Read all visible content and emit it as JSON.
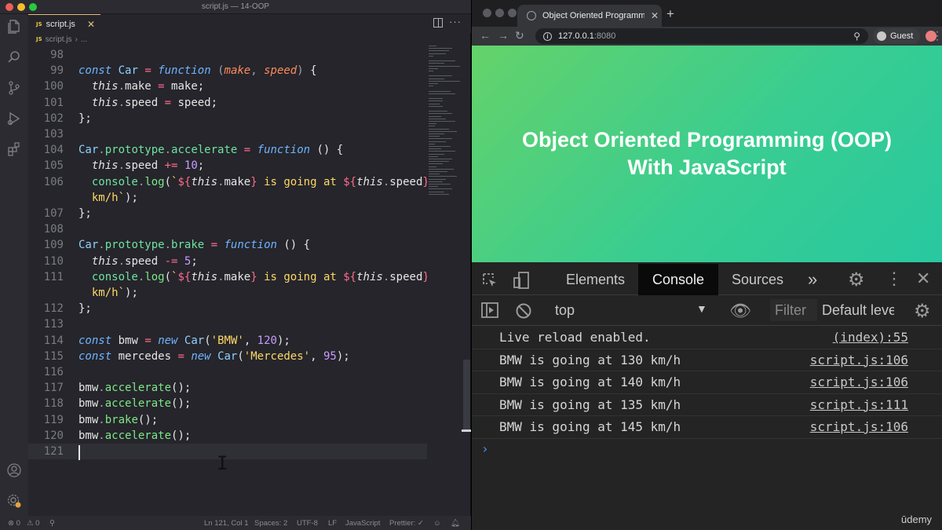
{
  "vscode": {
    "window_title": "script.js — 14-OOP",
    "tab": {
      "badge": "JS",
      "label": "script.js",
      "close": "✕"
    },
    "breadcrumb": {
      "badge": "JS",
      "file": "script.js",
      "sep": "›",
      "more": "..."
    },
    "lines": [
      {
        "n": "98",
        "tokens": []
      },
      {
        "n": "99",
        "tokens": [
          [
            "k",
            "const"
          ],
          [
            "t",
            " "
          ],
          [
            "cls",
            "Car"
          ],
          [
            "t",
            " "
          ],
          [
            "op",
            "="
          ],
          [
            "t",
            " "
          ],
          [
            "k",
            "function"
          ],
          [
            "t",
            " "
          ],
          [
            "pn",
            "("
          ],
          [
            "param",
            "make"
          ],
          [
            "pn",
            ", "
          ],
          [
            "param",
            "speed"
          ],
          [
            "pn",
            ")"
          ],
          [
            "t",
            " {"
          ]
        ]
      },
      {
        "n": "100",
        "tokens": [
          [
            "t",
            "  "
          ],
          [
            "th",
            "this"
          ],
          [
            "pn",
            "."
          ],
          [
            "t",
            "make "
          ],
          [
            "op",
            "="
          ],
          [
            "t",
            " make;"
          ]
        ]
      },
      {
        "n": "101",
        "tokens": [
          [
            "t",
            "  "
          ],
          [
            "th",
            "this"
          ],
          [
            "pn",
            "."
          ],
          [
            "t",
            "speed "
          ],
          [
            "op",
            "="
          ],
          [
            "t",
            " speed;"
          ]
        ]
      },
      {
        "n": "102",
        "tokens": [
          [
            "t",
            "};"
          ]
        ]
      },
      {
        "n": "103",
        "tokens": []
      },
      {
        "n": "104",
        "tokens": [
          [
            "cls",
            "Car"
          ],
          [
            "pn",
            "."
          ],
          [
            "prop",
            "prototype"
          ],
          [
            "pn",
            "."
          ],
          [
            "prop",
            "accelerate"
          ],
          [
            "t",
            " "
          ],
          [
            "op",
            "="
          ],
          [
            "t",
            " "
          ],
          [
            "k",
            "function"
          ],
          [
            "t",
            " () {"
          ]
        ]
      },
      {
        "n": "105",
        "tokens": [
          [
            "t",
            "  "
          ],
          [
            "th",
            "this"
          ],
          [
            "pn",
            "."
          ],
          [
            "t",
            "speed "
          ],
          [
            "op",
            "+="
          ],
          [
            "t",
            " "
          ],
          [
            "num",
            "10"
          ],
          [
            "t",
            ";"
          ]
        ]
      },
      {
        "n": "106",
        "tokens": [
          [
            "t",
            "  "
          ],
          [
            "prop",
            "console"
          ],
          [
            "pn",
            "."
          ],
          [
            "method",
            "log"
          ],
          [
            "t",
            "("
          ],
          [
            "str",
            "`"
          ],
          [
            "op",
            "${"
          ],
          [
            "th",
            "this"
          ],
          [
            "pn",
            "."
          ],
          [
            "t",
            "make"
          ],
          [
            "op",
            "}"
          ],
          [
            "str",
            " is going at "
          ],
          [
            "op",
            "${"
          ],
          [
            "th",
            "this"
          ],
          [
            "pn",
            "."
          ],
          [
            "t",
            "speed"
          ],
          [
            "op",
            "}"
          ]
        ]
      },
      {
        "n": "",
        "tokens": [
          [
            "t",
            "  "
          ],
          [
            "str",
            "km/h`"
          ],
          [
            "t",
            ");"
          ]
        ]
      },
      {
        "n": "107",
        "tokens": [
          [
            "t",
            "};"
          ]
        ]
      },
      {
        "n": "108",
        "tokens": []
      },
      {
        "n": "109",
        "tokens": [
          [
            "cls",
            "Car"
          ],
          [
            "pn",
            "."
          ],
          [
            "prop",
            "prototype"
          ],
          [
            "pn",
            "."
          ],
          [
            "prop",
            "brake"
          ],
          [
            "t",
            " "
          ],
          [
            "op",
            "="
          ],
          [
            "t",
            " "
          ],
          [
            "k",
            "function"
          ],
          [
            "t",
            " () {"
          ]
        ]
      },
      {
        "n": "110",
        "tokens": [
          [
            "t",
            "  "
          ],
          [
            "th",
            "this"
          ],
          [
            "pn",
            "."
          ],
          [
            "t",
            "speed "
          ],
          [
            "op",
            "-="
          ],
          [
            "t",
            " "
          ],
          [
            "num",
            "5"
          ],
          [
            "t",
            ";"
          ]
        ]
      },
      {
        "n": "111",
        "tokens": [
          [
            "t",
            "  "
          ],
          [
            "prop",
            "console"
          ],
          [
            "pn",
            "."
          ],
          [
            "method",
            "log"
          ],
          [
            "t",
            "("
          ],
          [
            "str",
            "`"
          ],
          [
            "op",
            "${"
          ],
          [
            "th",
            "this"
          ],
          [
            "pn",
            "."
          ],
          [
            "t",
            "make"
          ],
          [
            "op",
            "}"
          ],
          [
            "str",
            " is going at "
          ],
          [
            "op",
            "${"
          ],
          [
            "th",
            "this"
          ],
          [
            "pn",
            "."
          ],
          [
            "t",
            "speed"
          ],
          [
            "op",
            "}"
          ]
        ]
      },
      {
        "n": "",
        "tokens": [
          [
            "t",
            "  "
          ],
          [
            "str",
            "km/h`"
          ],
          [
            "t",
            ");"
          ]
        ]
      },
      {
        "n": "112",
        "tokens": [
          [
            "t",
            "};"
          ]
        ]
      },
      {
        "n": "113",
        "tokens": []
      },
      {
        "n": "114",
        "tokens": [
          [
            "k",
            "const"
          ],
          [
            "t",
            " bmw "
          ],
          [
            "op",
            "="
          ],
          [
            "t",
            " "
          ],
          [
            "k",
            "new"
          ],
          [
            "t",
            " "
          ],
          [
            "cls",
            "Car"
          ],
          [
            "t",
            "("
          ],
          [
            "str",
            "'BMW'"
          ],
          [
            "t",
            ", "
          ],
          [
            "num",
            "120"
          ],
          [
            "t",
            ");"
          ]
        ]
      },
      {
        "n": "115",
        "tokens": [
          [
            "k",
            "const"
          ],
          [
            "t",
            " mercedes "
          ],
          [
            "op",
            "="
          ],
          [
            "t",
            " "
          ],
          [
            "k",
            "new"
          ],
          [
            "t",
            " "
          ],
          [
            "cls",
            "Car"
          ],
          [
            "t",
            "("
          ],
          [
            "str",
            "'Mercedes'"
          ],
          [
            "t",
            ", "
          ],
          [
            "num",
            "95"
          ],
          [
            "t",
            ");"
          ]
        ]
      },
      {
        "n": "116",
        "tokens": []
      },
      {
        "n": "117",
        "tokens": [
          [
            "t",
            "bmw"
          ],
          [
            "pn",
            "."
          ],
          [
            "method",
            "accelerate"
          ],
          [
            "t",
            "();"
          ]
        ]
      },
      {
        "n": "118",
        "tokens": [
          [
            "t",
            "bmw"
          ],
          [
            "pn",
            "."
          ],
          [
            "method",
            "accelerate"
          ],
          [
            "t",
            "();"
          ]
        ]
      },
      {
        "n": "119",
        "tokens": [
          [
            "t",
            "bmw"
          ],
          [
            "pn",
            "."
          ],
          [
            "method",
            "brake"
          ],
          [
            "t",
            "();"
          ]
        ]
      },
      {
        "n": "120",
        "tokens": [
          [
            "t",
            "bmw"
          ],
          [
            "pn",
            "."
          ],
          [
            "method",
            "accelerate"
          ],
          [
            "t",
            "();"
          ]
        ]
      },
      {
        "n": "121",
        "tokens": [],
        "current": true
      }
    ],
    "status": {
      "errors": "⊗ 0",
      "warnings": "⚠ 0",
      "cursor": "Ln 121, Col 1",
      "spaces": "Spaces: 2",
      "encoding": "UTF-8",
      "eol": "LF",
      "language": "JavaScript",
      "prettier": "Prettier: ✓"
    },
    "activity_icons": [
      "explorer-icon",
      "search-icon",
      "source-control-icon",
      "run-debug-icon",
      "extensions-icon",
      "account-icon",
      "settings-gear-icon"
    ]
  },
  "browser": {
    "tab_title": "Object Oriented Programming",
    "tab_close": "✕",
    "new_tab": "+",
    "url_host": "127.0.0.1",
    "url_port": ":8080",
    "profile": "Guest",
    "page_heading_line1": "Object Oriented Programming (OOP)",
    "page_heading_line2": "With JavaScript",
    "heading_color": "#ffffff",
    "gradient": [
      "#65d26a",
      "#28c8a0"
    ]
  },
  "devtools": {
    "tabs": [
      "Elements",
      "Console",
      "Sources"
    ],
    "active_tab": "Console",
    "more_tabs": "»",
    "context": "top",
    "filter_placeholder": "Filter",
    "levels": "Default levels",
    "messages": [
      {
        "text": "Live reload enabled.",
        "source": "(index):55"
      },
      {
        "text": "BMW is going at 130 km/h",
        "source": "script.js:106"
      },
      {
        "text": "BMW is going at 140 km/h",
        "source": "script.js:106"
      },
      {
        "text": "BMW is going at 135 km/h",
        "source": "script.js:111"
      },
      {
        "text": "BMW is going at 145 km/h",
        "source": "script.js:106"
      }
    ],
    "prompt": "›"
  },
  "watermark": "ūdemy"
}
